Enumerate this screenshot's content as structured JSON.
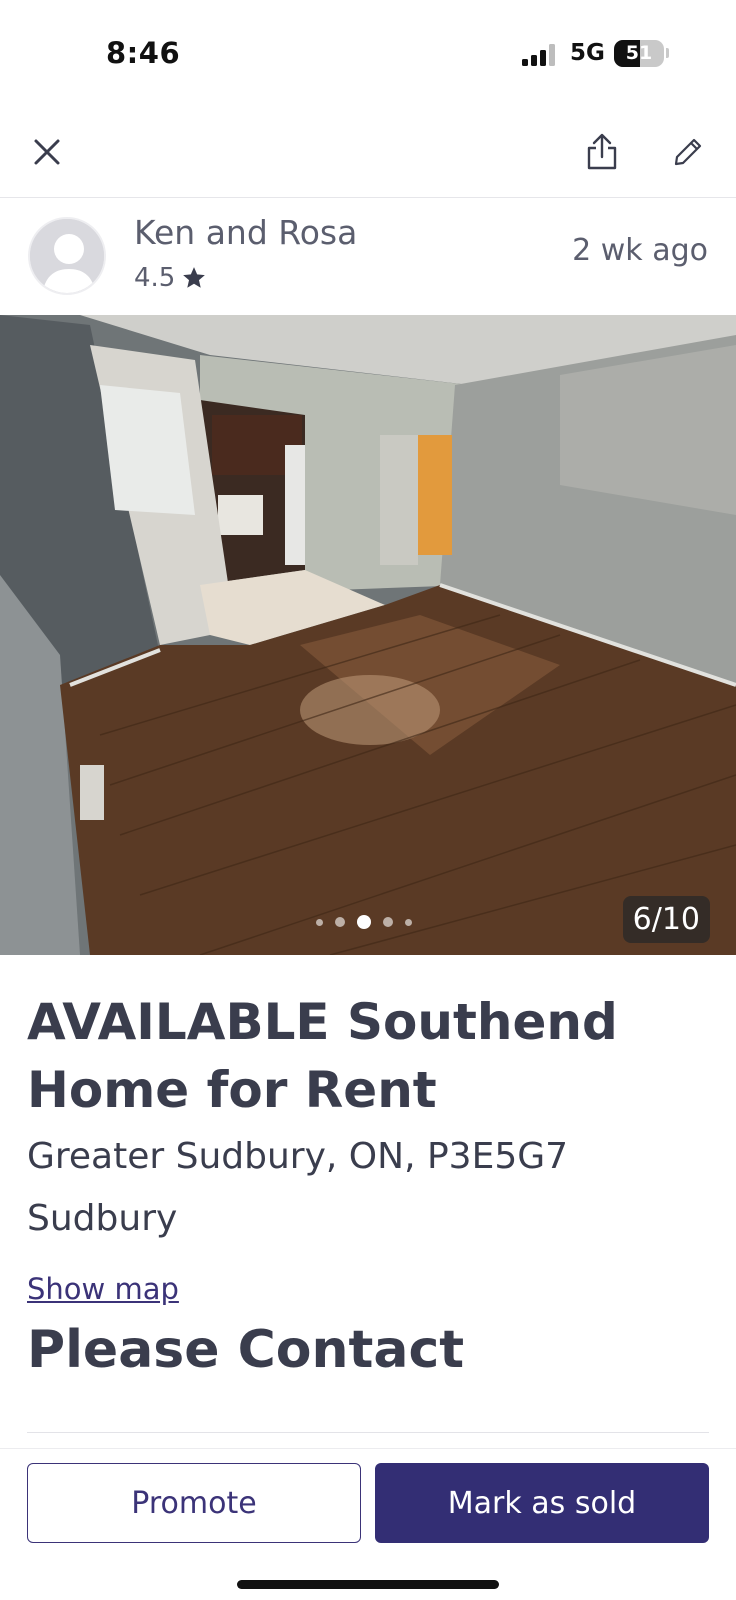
{
  "status_bar": {
    "time": "8:46",
    "network": "5G",
    "battery_level": "51",
    "battery_fraction": 0.51
  },
  "nav": {
    "close_icon": "close-icon",
    "share_icon": "share-icon",
    "edit_icon": "edit-pencil-icon"
  },
  "seller": {
    "name": "Ken and Rosa",
    "rating": "4.5",
    "rating_icon": "star-icon",
    "posted": "2 wk  ago"
  },
  "photo": {
    "counter": "6/10",
    "dots_count": 5,
    "active_dot": 2
  },
  "listing": {
    "title": "AVAILABLE Southend Home for Rent",
    "address": "Greater Sudbury, ON, P3E5G7",
    "city": "Sudbury",
    "show_map_label": "Show map",
    "price": "Please Contact"
  },
  "actions": {
    "promote_label": "Promote",
    "mark_sold_label": "Mark as sold"
  },
  "colors": {
    "accent": "#332e74",
    "text": "#3a3d4d",
    "muted_text": "#5b5e6e"
  }
}
